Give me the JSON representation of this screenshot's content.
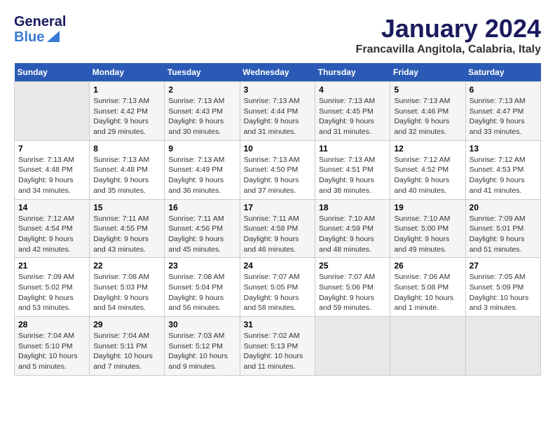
{
  "header": {
    "logo_general": "General",
    "logo_blue": "Blue",
    "month": "January 2024",
    "location": "Francavilla Angitola, Calabria, Italy"
  },
  "weekdays": [
    "Sunday",
    "Monday",
    "Tuesday",
    "Wednesday",
    "Thursday",
    "Friday",
    "Saturday"
  ],
  "weeks": [
    [
      {
        "day": "",
        "sunrise": "",
        "sunset": "",
        "daylight": ""
      },
      {
        "day": "1",
        "sunrise": "Sunrise: 7:13 AM",
        "sunset": "Sunset: 4:42 PM",
        "daylight": "Daylight: 9 hours and 29 minutes."
      },
      {
        "day": "2",
        "sunrise": "Sunrise: 7:13 AM",
        "sunset": "Sunset: 4:43 PM",
        "daylight": "Daylight: 9 hours and 30 minutes."
      },
      {
        "day": "3",
        "sunrise": "Sunrise: 7:13 AM",
        "sunset": "Sunset: 4:44 PM",
        "daylight": "Daylight: 9 hours and 31 minutes."
      },
      {
        "day": "4",
        "sunrise": "Sunrise: 7:13 AM",
        "sunset": "Sunset: 4:45 PM",
        "daylight": "Daylight: 9 hours and 31 minutes."
      },
      {
        "day": "5",
        "sunrise": "Sunrise: 7:13 AM",
        "sunset": "Sunset: 4:46 PM",
        "daylight": "Daylight: 9 hours and 32 minutes."
      },
      {
        "day": "6",
        "sunrise": "Sunrise: 7:13 AM",
        "sunset": "Sunset: 4:47 PM",
        "daylight": "Daylight: 9 hours and 33 minutes."
      }
    ],
    [
      {
        "day": "7",
        "sunrise": "Sunrise: 7:13 AM",
        "sunset": "Sunset: 4:48 PM",
        "daylight": "Daylight: 9 hours and 34 minutes."
      },
      {
        "day": "8",
        "sunrise": "Sunrise: 7:13 AM",
        "sunset": "Sunset: 4:48 PM",
        "daylight": "Daylight: 9 hours and 35 minutes."
      },
      {
        "day": "9",
        "sunrise": "Sunrise: 7:13 AM",
        "sunset": "Sunset: 4:49 PM",
        "daylight": "Daylight: 9 hours and 36 minutes."
      },
      {
        "day": "10",
        "sunrise": "Sunrise: 7:13 AM",
        "sunset": "Sunset: 4:50 PM",
        "daylight": "Daylight: 9 hours and 37 minutes."
      },
      {
        "day": "11",
        "sunrise": "Sunrise: 7:13 AM",
        "sunset": "Sunset: 4:51 PM",
        "daylight": "Daylight: 9 hours and 38 minutes."
      },
      {
        "day": "12",
        "sunrise": "Sunrise: 7:12 AM",
        "sunset": "Sunset: 4:52 PM",
        "daylight": "Daylight: 9 hours and 40 minutes."
      },
      {
        "day": "13",
        "sunrise": "Sunrise: 7:12 AM",
        "sunset": "Sunset: 4:53 PM",
        "daylight": "Daylight: 9 hours and 41 minutes."
      }
    ],
    [
      {
        "day": "14",
        "sunrise": "Sunrise: 7:12 AM",
        "sunset": "Sunset: 4:54 PM",
        "daylight": "Daylight: 9 hours and 42 minutes."
      },
      {
        "day": "15",
        "sunrise": "Sunrise: 7:11 AM",
        "sunset": "Sunset: 4:55 PM",
        "daylight": "Daylight: 9 hours and 43 minutes."
      },
      {
        "day": "16",
        "sunrise": "Sunrise: 7:11 AM",
        "sunset": "Sunset: 4:56 PM",
        "daylight": "Daylight: 9 hours and 45 minutes."
      },
      {
        "day": "17",
        "sunrise": "Sunrise: 7:11 AM",
        "sunset": "Sunset: 4:58 PM",
        "daylight": "Daylight: 9 hours and 46 minutes."
      },
      {
        "day": "18",
        "sunrise": "Sunrise: 7:10 AM",
        "sunset": "Sunset: 4:59 PM",
        "daylight": "Daylight: 9 hours and 48 minutes."
      },
      {
        "day": "19",
        "sunrise": "Sunrise: 7:10 AM",
        "sunset": "Sunset: 5:00 PM",
        "daylight": "Daylight: 9 hours and 49 minutes."
      },
      {
        "day": "20",
        "sunrise": "Sunrise: 7:09 AM",
        "sunset": "Sunset: 5:01 PM",
        "daylight": "Daylight: 9 hours and 51 minutes."
      }
    ],
    [
      {
        "day": "21",
        "sunrise": "Sunrise: 7:09 AM",
        "sunset": "Sunset: 5:02 PM",
        "daylight": "Daylight: 9 hours and 53 minutes."
      },
      {
        "day": "22",
        "sunrise": "Sunrise: 7:08 AM",
        "sunset": "Sunset: 5:03 PM",
        "daylight": "Daylight: 9 hours and 54 minutes."
      },
      {
        "day": "23",
        "sunrise": "Sunrise: 7:08 AM",
        "sunset": "Sunset: 5:04 PM",
        "daylight": "Daylight: 9 hours and 56 minutes."
      },
      {
        "day": "24",
        "sunrise": "Sunrise: 7:07 AM",
        "sunset": "Sunset: 5:05 PM",
        "daylight": "Daylight: 9 hours and 58 minutes."
      },
      {
        "day": "25",
        "sunrise": "Sunrise: 7:07 AM",
        "sunset": "Sunset: 5:06 PM",
        "daylight": "Daylight: 9 hours and 59 minutes."
      },
      {
        "day": "26",
        "sunrise": "Sunrise: 7:06 AM",
        "sunset": "Sunset: 5:08 PM",
        "daylight": "Daylight: 10 hours and 1 minute."
      },
      {
        "day": "27",
        "sunrise": "Sunrise: 7:05 AM",
        "sunset": "Sunset: 5:09 PM",
        "daylight": "Daylight: 10 hours and 3 minutes."
      }
    ],
    [
      {
        "day": "28",
        "sunrise": "Sunrise: 7:04 AM",
        "sunset": "Sunset: 5:10 PM",
        "daylight": "Daylight: 10 hours and 5 minutes."
      },
      {
        "day": "29",
        "sunrise": "Sunrise: 7:04 AM",
        "sunset": "Sunset: 5:11 PM",
        "daylight": "Daylight: 10 hours and 7 minutes."
      },
      {
        "day": "30",
        "sunrise": "Sunrise: 7:03 AM",
        "sunset": "Sunset: 5:12 PM",
        "daylight": "Daylight: 10 hours and 9 minutes."
      },
      {
        "day": "31",
        "sunrise": "Sunrise: 7:02 AM",
        "sunset": "Sunset: 5:13 PM",
        "daylight": "Daylight: 10 hours and 11 minutes."
      },
      {
        "day": "",
        "sunrise": "",
        "sunset": "",
        "daylight": ""
      },
      {
        "day": "",
        "sunrise": "",
        "sunset": "",
        "daylight": ""
      },
      {
        "day": "",
        "sunrise": "",
        "sunset": "",
        "daylight": ""
      }
    ]
  ]
}
